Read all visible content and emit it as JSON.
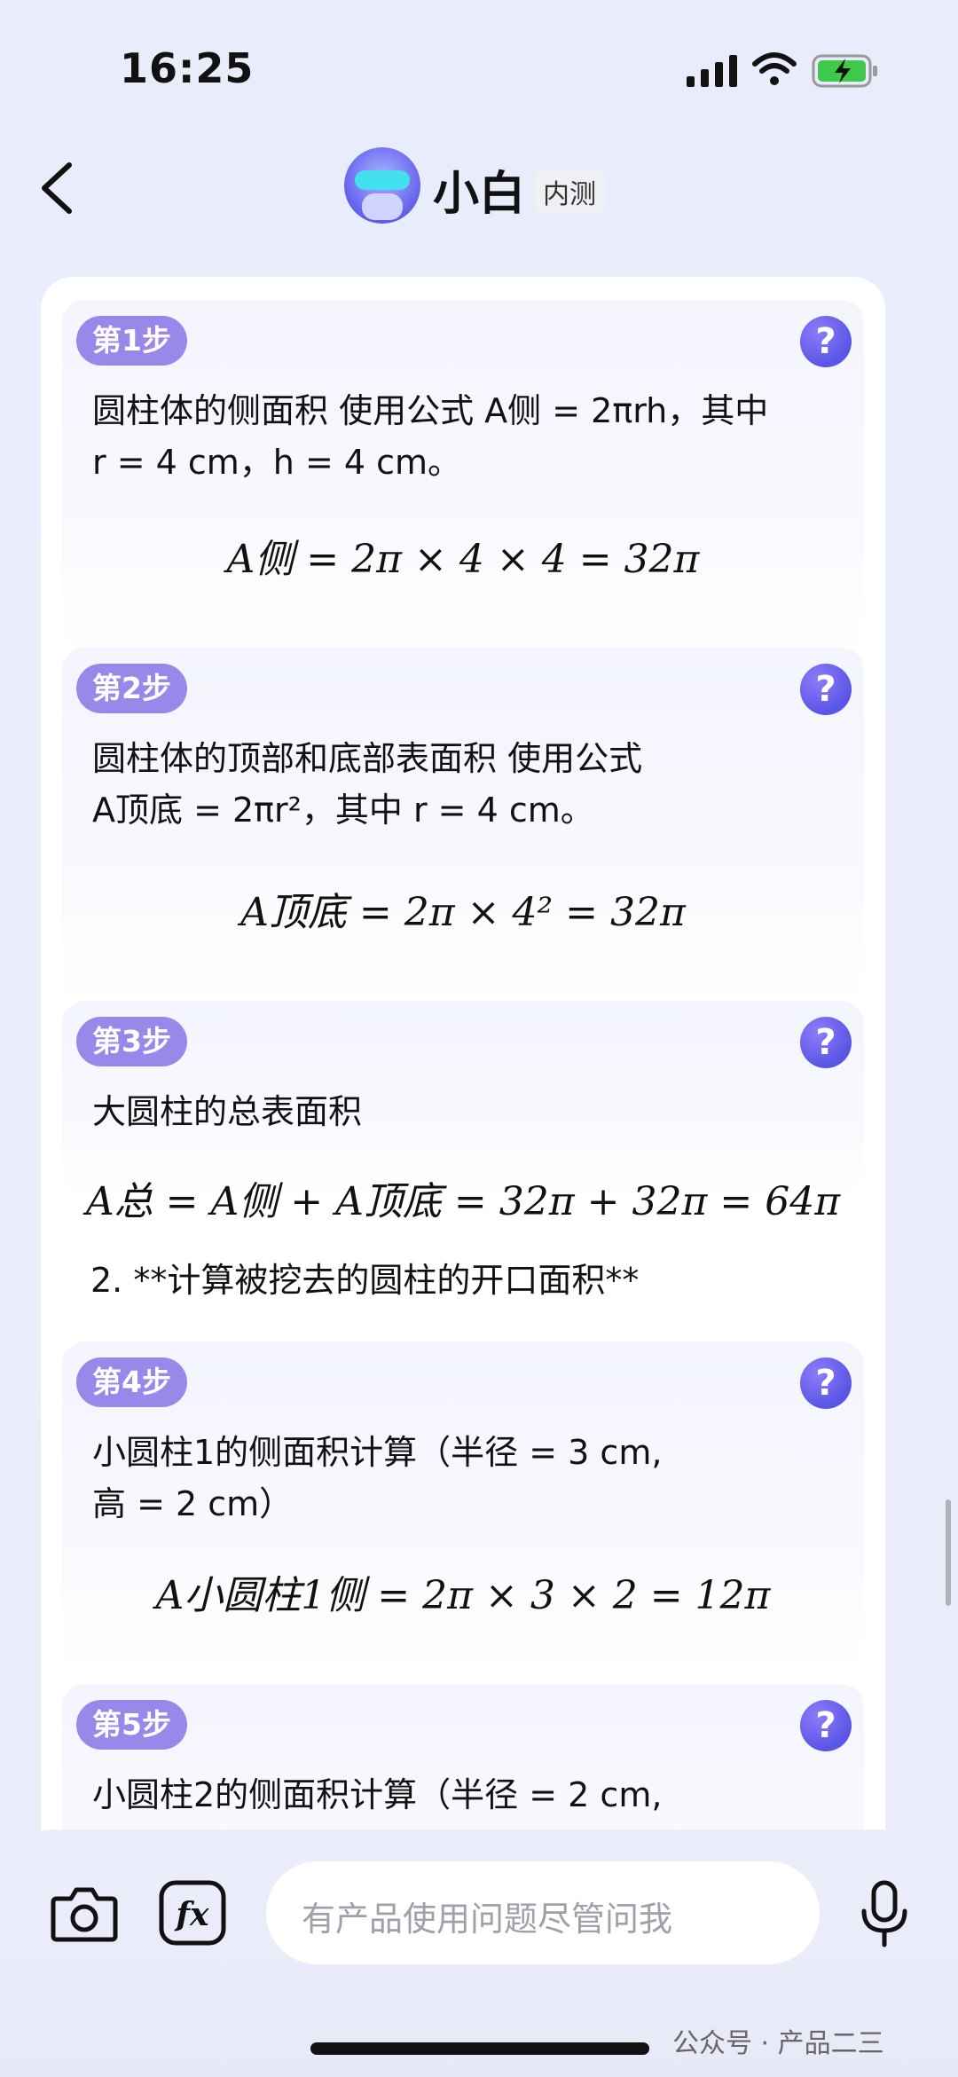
{
  "status": {
    "time": "16:25"
  },
  "header": {
    "title": "小白",
    "badge": "内测"
  },
  "steps": [
    {
      "badge": "第1步",
      "text": "圆柱体的侧面积 使用公式 A侧 = 2πrh，其中\nr = 4 cm，h = 4 cm。",
      "formula": "A侧 = 2π × 4 × 4 = 32π"
    },
    {
      "badge": "第2步",
      "text": "圆柱体的顶部和底部表面积 使用公式\nA顶底 = 2πr²，其中 r = 4 cm。",
      "formula": "A顶底 = 2π × 4² = 32π"
    },
    {
      "badge": "第3步",
      "text": "大圆柱的总表面积",
      "formula": "A总 = A侧 + A顶底 = 32π + 32π = 64π"
    },
    {
      "badge": "第4步",
      "text": "小圆柱1的侧面积计算（半径 = 3 cm,\n高 = 2 cm）",
      "formula": "A小圆柱1侧 = 2π × 3 × 2 = 12π"
    },
    {
      "badge": "第5步",
      "text": "小圆柱2的侧面积计算（半径 = 2 cm,",
      "formula": ""
    }
  ],
  "section_heading": "2. **计算被挖去的圆柱的开口面积**",
  "input": {
    "placeholder": "有产品使用问题尽管问我"
  },
  "watermark": "公众号 · 产品二三",
  "help_symbol": "?",
  "icons": [
    "back-icon",
    "camera-icon",
    "formula-fx-icon",
    "microphone-icon",
    "signal-icon",
    "wifi-icon",
    "battery-charging-icon",
    "help-icon"
  ]
}
